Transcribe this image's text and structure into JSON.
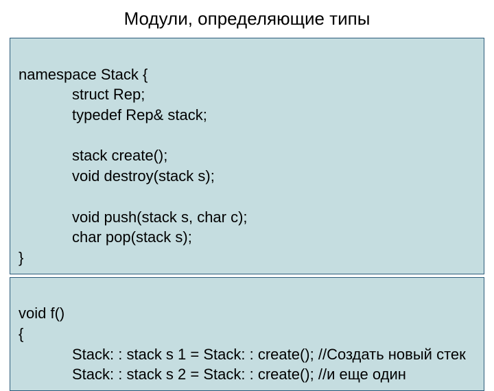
{
  "title": "Модули, определяющие типы",
  "block1": {
    "l1": "namespace Stack {",
    "l2": "struct Rep;",
    "l3": "typedef Rep& stack;",
    "l4": "stack create();",
    "l5": "void destroy(stack s);",
    "l6": "void push(stack s, char c);",
    "l7": "char pop(stack s);",
    "l8": "}"
  },
  "block2": {
    "l1": "void f()",
    "l2": "{",
    "l3": "Stack: : stack s 1 = Stack: : create(); //Создать новый стек",
    "l4": "Stack: : stack s 2 = Stack: : create(); //и еще один"
  }
}
